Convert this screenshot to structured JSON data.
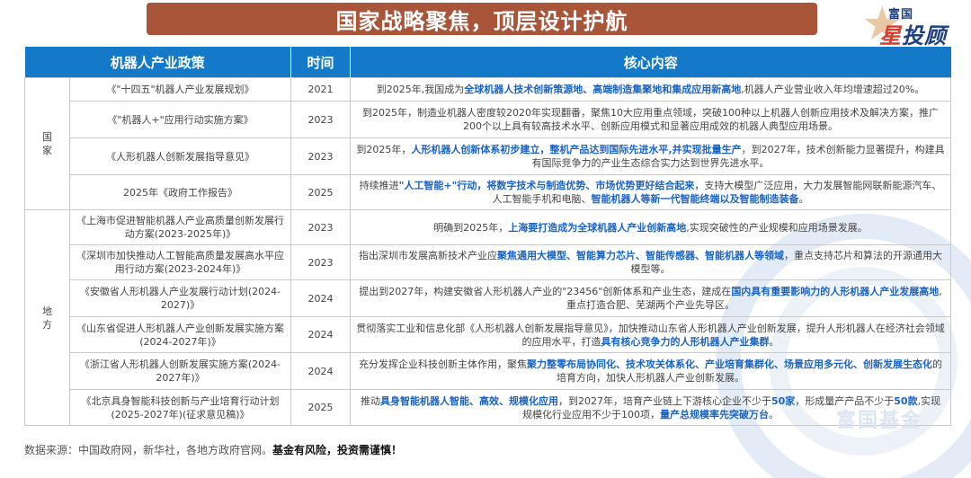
{
  "title": "国家战略聚焦，顶层设计护航",
  "logo": {
    "small": "富国",
    "big_left": "星",
    "big_right": "投顾"
  },
  "watermark_text": "富国基金",
  "table": {
    "headers": [
      "机器人产业政策",
      "时间",
      "核心内容"
    ],
    "groups": [
      {
        "region": "国家",
        "rows": [
          {
            "policy": "《\"十四五\"机器人产业发展规划》",
            "year": "2021",
            "content": [
              {
                "t": "到2025年,我国成为"
              },
              {
                "t": "全球机器人技术创新策源地、高端制造集聚地和集成应用新高地",
                "h": true
              },
              {
                "t": ",机器人产业营业收入年均增速超过20%。"
              }
            ]
          },
          {
            "policy": "《\"机器人+\"应用行动实施方案》",
            "year": "2023",
            "content": [
              {
                "t": "到2025年，制造业机器人密度较2020年实现翻番，聚焦10大应用重点领域，突破100种以上机器人创新应用技术及解决方案，推广200个以上具有较高技术水平、创新应用模式和显著应用成效的机器人典型应用场景。"
              }
            ]
          },
          {
            "policy": "《人形机器人创新发展指导意见》",
            "year": "2023",
            "content": [
              {
                "t": "到2025年，"
              },
              {
                "t": "人形机器人创新体系初步建立，整机产品达到国际先进水平,并实现批量生产",
                "h": true
              },
              {
                "t": "，到2027年，技术创新能力显著提升，构建具有国际竞争力的产业生态综合实力达到世界先进水平。"
              }
            ]
          },
          {
            "policy": "2025年《政府工作报告》",
            "year": "2025",
            "content": [
              {
                "t": "持续推进"
              },
              {
                "t": "\"人工智能+\"行动，将数字技术与制造优势、市场优势更好结合起来",
                "h": true
              },
              {
                "t": "，支持大模型广泛应用，大力发展智能网联新能源汽车、人工智能手机和电脑、"
              },
              {
                "t": "智能机器人等新一代智能终端以及智能制造装备",
                "h": true
              },
              {
                "t": "。"
              }
            ]
          }
        ]
      },
      {
        "region": "地方",
        "rows": [
          {
            "policy": "《上海市促进智能机器人产业高质量创新发展行动方案(2023-2025年)》",
            "year": "2023",
            "content": [
              {
                "t": "明确到2025年，"
              },
              {
                "t": "上海要打造成为全球机器人产业创新高地",
                "h": true
              },
              {
                "t": ",实现突破性的产业规模和应用场景发展。"
              }
            ]
          },
          {
            "policy": "《深圳市加快推动人工智能高质量发展高水平应用行动方案(2023-2024年)》",
            "year": "2023",
            "content": [
              {
                "t": "指出深圳市发展高新技术产业应"
              },
              {
                "t": "聚焦通用大模型、智能算力芯片、智能传感器、智能机器人等领域",
                "h": true
              },
              {
                "t": "，重点支持芯片和算法的开源通用大模型等。"
              }
            ]
          },
          {
            "policy": "《安徽省人形机器人产业发展行动计划(2024-2027)》",
            "year": "2024",
            "content": [
              {
                "t": "提出到2027年，构建安徽省人形机器人产业的\"23456\"创新体系和产业生态，建成在"
              },
              {
                "t": "国内具有重要影响力的人形机器人产业发展高地",
                "h": true
              },
              {
                "t": ",重点打造合肥、芜湖两个产业先导区。"
              }
            ]
          },
          {
            "policy": "《山东省促进人形机器人产业创新发展实施方案(2024-2027年)》",
            "year": "2024",
            "content": [
              {
                "t": "贯彻落实工业和信息化部《人形机器人创新发展指导意见》，加快推动山东省人形机器人产业创新发展，提升人形机器人在经济社会领域的应用水平，打造"
              },
              {
                "t": "具有核心竞争力的人形机器人产业集群",
                "h": true
              },
              {
                "t": "。"
              }
            ]
          },
          {
            "policy": "《浙江省人形机器人创新发展实施方案(2024-2027年)》",
            "year": "2024",
            "content": [
              {
                "t": "充分发挥企业科技创新主体作用，聚焦"
              },
              {
                "t": "聚力整零布局协同化、技术攻关体系化、产业培育集群化、场景应用多元化、创新发展生态化",
                "h": true
              },
              {
                "t": "的培育方向，加快人形机器人产业创新发展。"
              }
            ]
          },
          {
            "policy": "《北京具身智能科技创新与产业培育行动计划(2025-2027年)(征求意见稿)》",
            "year": "2025",
            "content": [
              {
                "t": "推动"
              },
              {
                "t": "具身智能机器人智能、高效、规模化应用",
                "h": true
              },
              {
                "t": "，到2027年，培育产业链上下游核心企业不少于"
              },
              {
                "t": "50家",
                "h": true
              },
              {
                "t": "，形成量产产品不少于"
              },
              {
                "t": "50款",
                "h": true
              },
              {
                "t": ",实现规模化行业应用不少于100项，"
              },
              {
                "t": "量产总规模率先突破万台",
                "h": true
              },
              {
                "t": "。"
              }
            ]
          }
        ]
      }
    ]
  },
  "footer": {
    "source": "数据来源：中国政府网，新华社，各地方政府官网。",
    "warning": "基金有风险，投资需谨慎！"
  },
  "colors": {
    "title_bg": "#a9553a",
    "header_bg": "#1479c8",
    "highlight": "#1a63c5"
  }
}
